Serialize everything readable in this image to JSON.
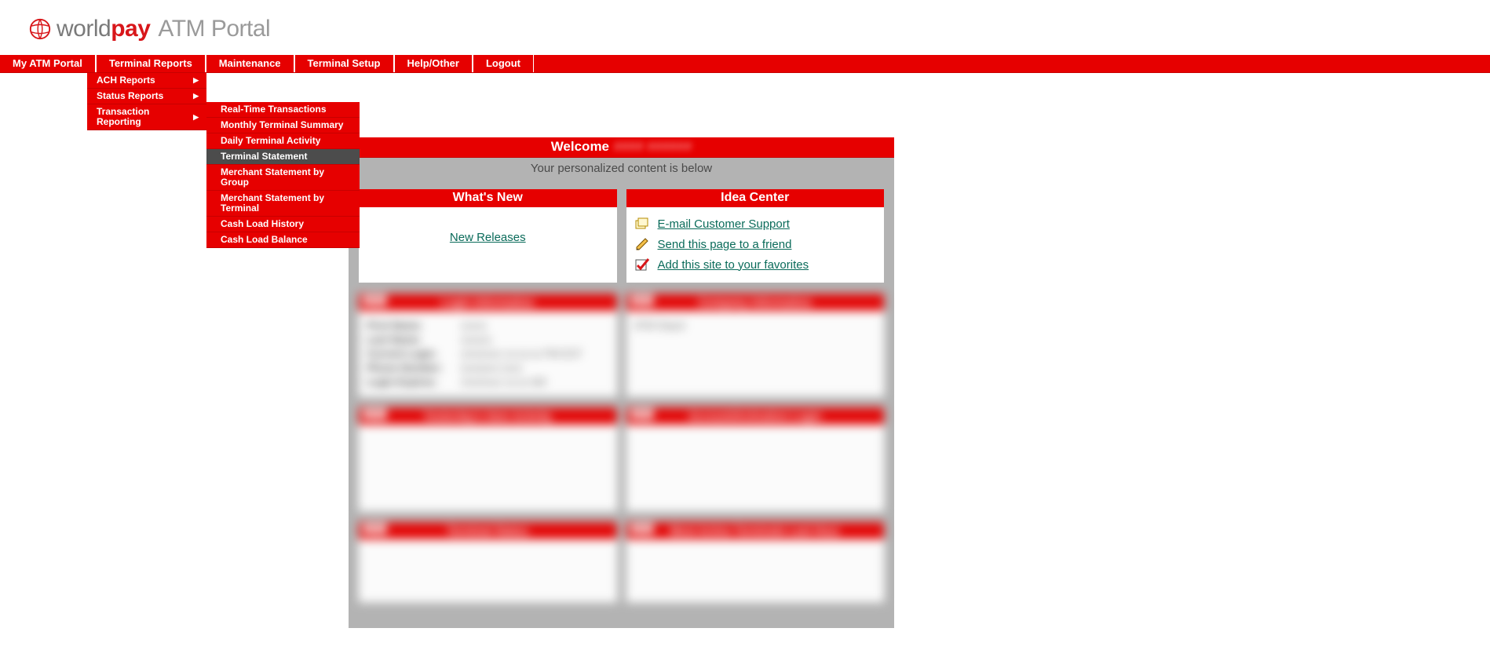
{
  "logo": {
    "world": "world",
    "pay": "pay",
    "portal": "ATM Portal"
  },
  "nav": {
    "items": [
      {
        "label": "My ATM Portal"
      },
      {
        "label": "Terminal Reports"
      },
      {
        "label": "Maintenance"
      },
      {
        "label": "Terminal Setup"
      },
      {
        "label": "Help/Other"
      },
      {
        "label": "Logout"
      }
    ]
  },
  "dropdown": {
    "items": [
      {
        "label": "ACH Reports",
        "arrow": true
      },
      {
        "label": "Status Reports",
        "arrow": true
      },
      {
        "label": "Transaction Reporting",
        "arrow": true
      }
    ]
  },
  "submenu": {
    "items": [
      {
        "label": "Real-Time Transactions"
      },
      {
        "label": "Monthly Terminal Summary"
      },
      {
        "label": "Daily Terminal Activity"
      },
      {
        "label": "Terminal Statement",
        "hovered": true
      },
      {
        "label": "Merchant Statement by Group"
      },
      {
        "label": "Merchant Statement by Terminal"
      },
      {
        "label": "Cash Load History"
      },
      {
        "label": "Cash Load Balance"
      }
    ]
  },
  "welcome": {
    "prefix": "Welcome",
    "user": "####  ######"
  },
  "subwelcome": "Your personalized content is below",
  "panels": {
    "whatsnew": {
      "title": "What's New",
      "link": "New Releases"
    },
    "idea": {
      "title": "Idea Center",
      "links": [
        "E-mail Customer Support",
        "Send this page to a friend",
        "Add this site to your favorites"
      ]
    }
  },
  "blurred": {
    "login_info_title": "Login Information",
    "company_info_title": "Company Information",
    "yest_title": "Yesterday's Item Activity",
    "acct_title": "Account/Activation Login",
    "term_title": "Terminal Status",
    "active_title": "Most Active Terminals Last Hour",
    "badge": "Edit",
    "login_rows": [
      {
        "k": "First Name:",
        "v": "xxxxx"
      },
      {
        "k": "Last Name:",
        "v": "xxxxxx"
      },
      {
        "k": "Current Login:",
        "v": "x/xx/xxxx xx:xx:xx PM EST"
      },
      {
        "k": "Phone Number:",
        "v": "(xxx)xxx-xxxx"
      },
      {
        "k": "Login Expires:",
        "v": "x/xx/xxxx xx:xx AM"
      }
    ],
    "company_row": "ATM Depot"
  }
}
